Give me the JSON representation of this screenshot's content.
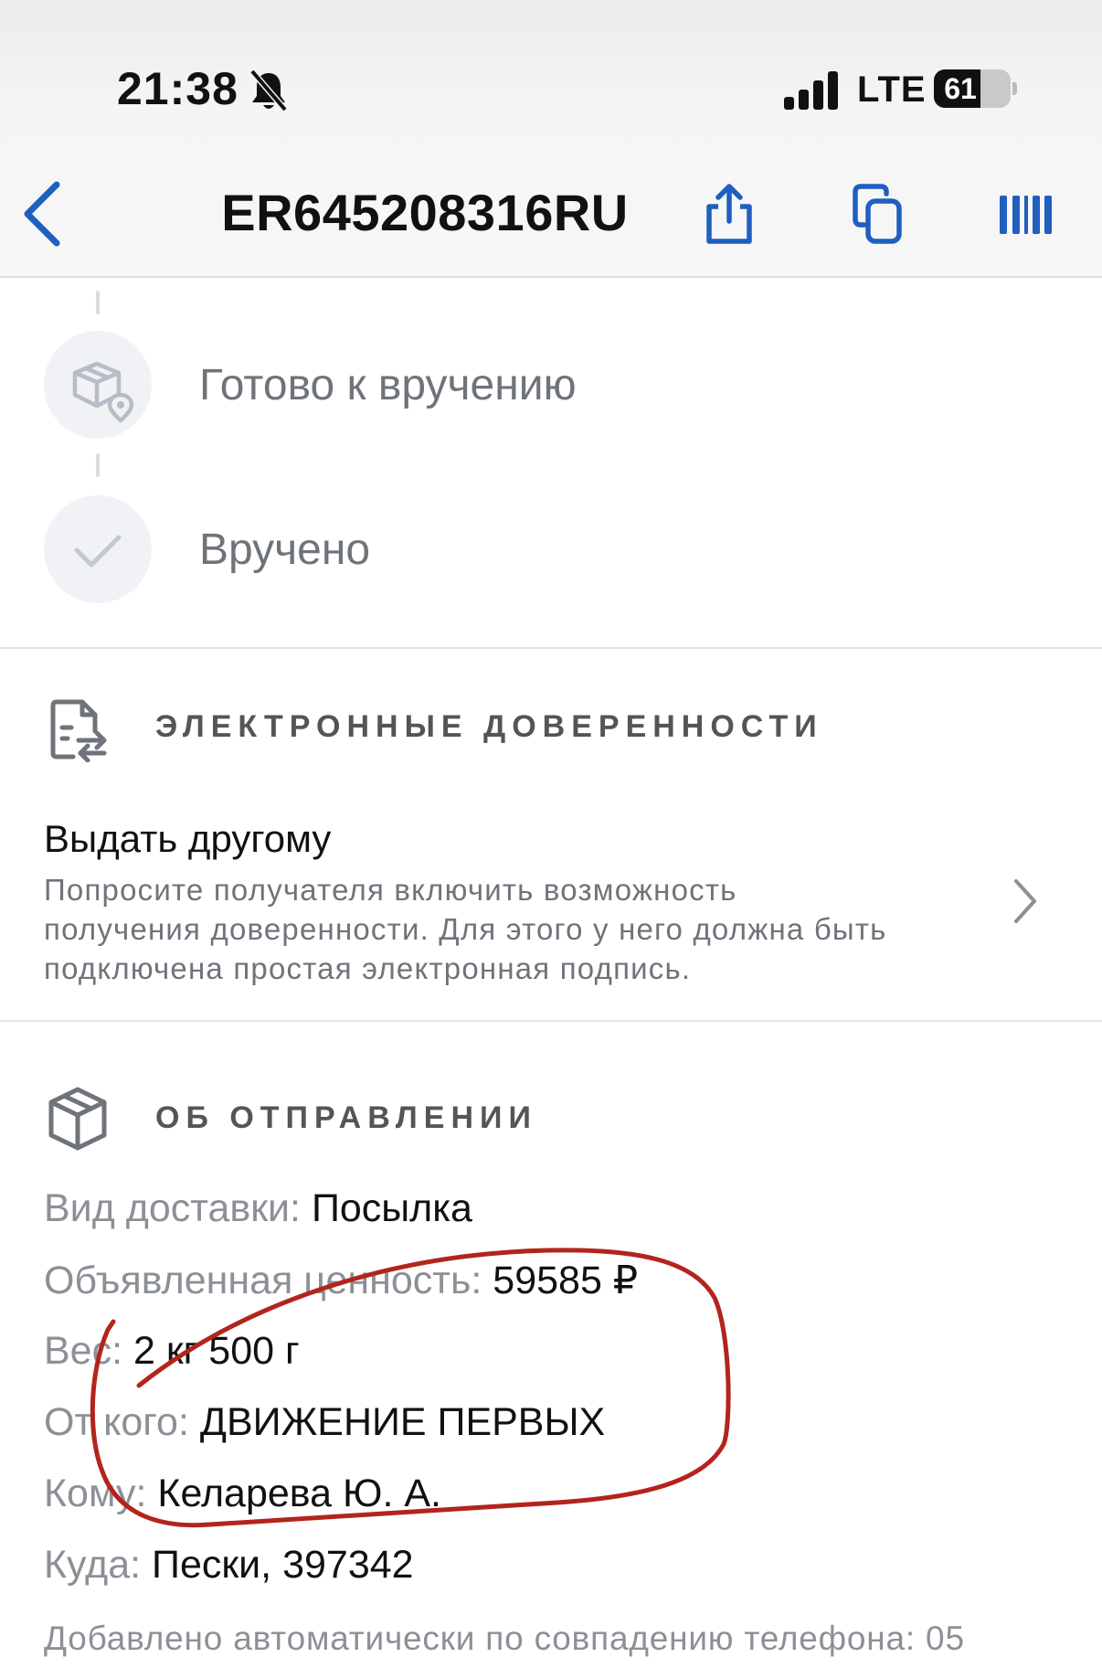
{
  "status_bar": {
    "time": "21:38",
    "network": "LTE",
    "battery": "61",
    "battery_level": 0.61
  },
  "header": {
    "title": "ER645208316RU"
  },
  "timeline": {
    "steps": [
      {
        "label": "Готово к вручению",
        "icon": "box-location-icon"
      },
      {
        "label": "Вручено",
        "icon": "checkmark-icon"
      }
    ]
  },
  "delegation": {
    "section_title": "ЭЛЕКТРОННЫЕ ДОВЕРЕННОСТИ",
    "title": "Выдать другому",
    "description": "Попросите получателя включить возможность получения доверенности. Для этого у него должна быть подключена простая электронная подпись."
  },
  "shipment": {
    "section_title": "ОБ ОТПРАВЛЕНИИ",
    "rows": [
      {
        "label": "Вид доставки:",
        "value": "Посылка"
      },
      {
        "label": "Объявленная ценность:",
        "value": "59585 ₽"
      },
      {
        "label": "Вес:",
        "value": "2 кг 500 г"
      },
      {
        "label": "От кого:",
        "value": "ДВИЖЕНИЕ ПЕРВЫХ"
      },
      {
        "label": "Кому:",
        "value": "Келарева Ю. А."
      },
      {
        "label": "Куда:",
        "value": "Пески, 397342"
      }
    ],
    "footer_note": "Добавлено автоматически по совпадению телефона: 05"
  },
  "colors": {
    "accent": "#1f5fbf",
    "annotation": "#b3241c",
    "muted_text": "#8c9096"
  }
}
